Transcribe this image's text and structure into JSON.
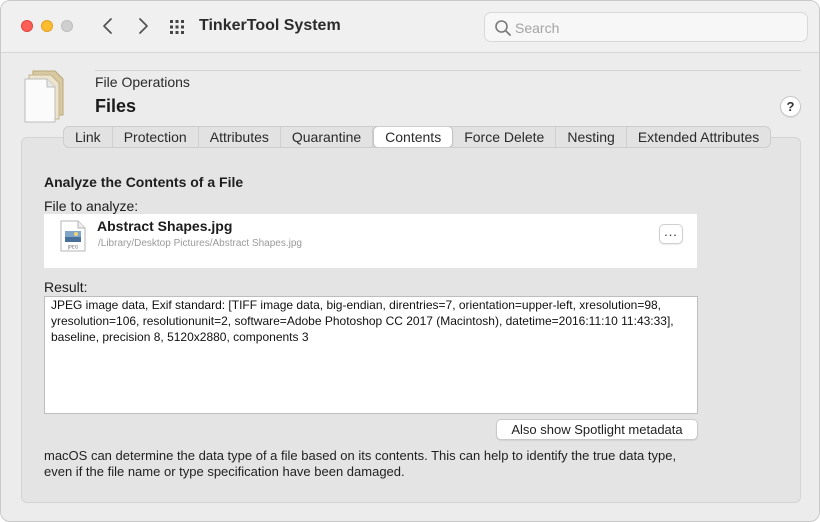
{
  "app": {
    "title": "TinkerTool System"
  },
  "search": {
    "placeholder": "Search"
  },
  "header": {
    "section": "File Operations",
    "title": "Files",
    "help_label": "?"
  },
  "tabs": [
    {
      "label": "Link"
    },
    {
      "label": "Protection"
    },
    {
      "label": "Attributes"
    },
    {
      "label": "Quarantine"
    },
    {
      "label": "Contents",
      "active": true
    },
    {
      "label": "Force Delete"
    },
    {
      "label": "Nesting"
    },
    {
      "label": "Extended Attributes"
    }
  ],
  "content": {
    "heading": "Analyze the Contents of a File",
    "file_label": "File to analyze:",
    "file": {
      "name": "Abstract Shapes.jpg",
      "path": "/Library/Desktop Pictures/Abstract Shapes.jpg",
      "more_label": "..."
    },
    "result_label": "Result:",
    "result_text": "JPEG image data, Exif standard: [TIFF image data, big-endian, direntries=7, orientation=upper-left, xresolution=98, yresolution=106, resolutionunit=2, software=Adobe Photoshop CC 2017 (Macintosh), datetime=2016:11:10 11:43:33], baseline, precision 8, 5120x2880, components 3",
    "spotlight_button": "Also show Spotlight metadata",
    "description": "macOS can determine the data type of a file based on its contents. This can help to identify the true data type, even if the file name or type specification have been damaged."
  },
  "colors": {
    "close": "#fe5f57",
    "minimize": "#febc2e",
    "maximize": "#cfcfcf",
    "panel": "#e4e4e4"
  }
}
